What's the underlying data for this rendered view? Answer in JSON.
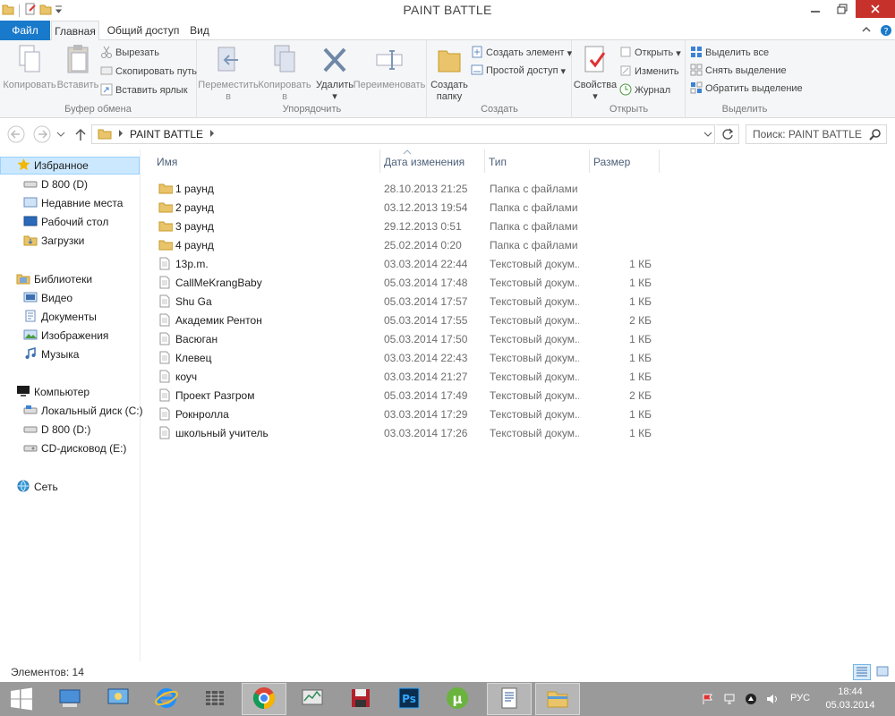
{
  "window": {
    "title": "PAINT BATTLE"
  },
  "tabs": {
    "file": "Файл",
    "home": "Главная",
    "share": "Общий доступ",
    "view": "Вид"
  },
  "ribbon": {
    "clipboard": {
      "label": "Буфер обмена",
      "copy": "Копировать",
      "paste": "Вставить",
      "cut": "Вырезать",
      "copy_path": "Скопировать путь",
      "paste_shortcut": "Вставить ярлык"
    },
    "organize": {
      "label": "Упорядочить",
      "move_to_1": "Переместить",
      "move_to_2": "в",
      "copy_to_1": "Копировать",
      "copy_to_2": "в",
      "delete": "Удалить",
      "rename": "Переименовать"
    },
    "create": {
      "label": "Создать",
      "new_folder_1": "Создать",
      "new_folder_2": "папку",
      "new_item": "Создать элемент",
      "easy_access": "Простой доступ"
    },
    "open": {
      "label": "Открыть",
      "properties": "Свойства",
      "open": "Открыть",
      "edit": "Изменить",
      "history": "Журнал"
    },
    "select": {
      "label": "Выделить",
      "select_all": "Выделить все",
      "select_none": "Снять выделение",
      "invert": "Обратить выделение"
    }
  },
  "address": {
    "path": "PAINT BATTLE",
    "search_placeholder": "Поиск: PAINT BATTLE"
  },
  "nav": {
    "favorites": "Избранное",
    "fav_items": [
      "D 800 (D)",
      "Недавние места",
      "Рабочий стол",
      "Загрузки"
    ],
    "libraries": "Библиотеки",
    "lib_items": [
      "Видео",
      "Документы",
      "Изображения",
      "Музыка"
    ],
    "computer": "Компьютер",
    "comp_items": [
      "Локальный диск (C:)",
      "D 800 (D:)",
      "CD-дисковод (E:)"
    ],
    "network": "Сеть"
  },
  "columns": {
    "name": "Имя",
    "date": "Дата изменения",
    "type": "Тип",
    "size": "Размер"
  },
  "files": [
    {
      "name": "1 раунд",
      "date": "28.10.2013 21:25",
      "type": "Папка с файлами",
      "size": "",
      "kind": "folder"
    },
    {
      "name": "2 раунд",
      "date": "03.12.2013 19:54",
      "type": "Папка с файлами",
      "size": "",
      "kind": "folder"
    },
    {
      "name": "3 раунд",
      "date": "29.12.2013 0:51",
      "type": "Папка с файлами",
      "size": "",
      "kind": "folder"
    },
    {
      "name": "4 раунд",
      "date": "25.02.2014 0:20",
      "type": "Папка с файлами",
      "size": "",
      "kind": "folder"
    },
    {
      "name": "13p.m.",
      "date": "03.03.2014 22:44",
      "type": "Текстовый докум...",
      "size": "1 КБ",
      "kind": "text"
    },
    {
      "name": "CallMeKrangBaby",
      "date": "05.03.2014 17:48",
      "type": "Текстовый докум...",
      "size": "1 КБ",
      "kind": "text"
    },
    {
      "name": "Shu Ga",
      "date": "05.03.2014 17:57",
      "type": "Текстовый докум...",
      "size": "1 КБ",
      "kind": "text"
    },
    {
      "name": "Академик Рентон",
      "date": "05.03.2014 17:55",
      "type": "Текстовый докум...",
      "size": "2 КБ",
      "kind": "text"
    },
    {
      "name": "Васюган",
      "date": "05.03.2014 17:50",
      "type": "Текстовый докум...",
      "size": "1 КБ",
      "kind": "text"
    },
    {
      "name": "Клевец",
      "date": "03.03.2014 22:43",
      "type": "Текстовый докум...",
      "size": "1 КБ",
      "kind": "text"
    },
    {
      "name": "коуч",
      "date": "03.03.2014 21:27",
      "type": "Текстовый докум...",
      "size": "1 КБ",
      "kind": "text"
    },
    {
      "name": "Проект Разгром",
      "date": "05.03.2014 17:49",
      "type": "Текстовый докум...",
      "size": "2 КБ",
      "kind": "text"
    },
    {
      "name": "Рокнролла",
      "date": "03.03.2014 17:29",
      "type": "Текстовый докум...",
      "size": "1 КБ",
      "kind": "text"
    },
    {
      "name": "школьный учитель",
      "date": "03.03.2014 17:26",
      "type": "Текстовый докум...",
      "size": "1 КБ",
      "kind": "text"
    }
  ],
  "status": {
    "items": "Элементов: 14"
  },
  "taskbar": {
    "apps": [
      "network-settings-icon",
      "control-panel-icon",
      "internet-explorer-icon",
      "media-app-icon",
      "chrome-icon",
      "task-manager-icon",
      "save-app-icon",
      "photoshop-icon",
      "utorrent-icon",
      "word-document-icon",
      "file-explorer-icon"
    ],
    "lang": "РУС",
    "time": "18:44",
    "date": "05.03.2014"
  },
  "colors": {
    "accent": "#1979ca",
    "folder": "#e9c46a",
    "selection": "#cce8ff",
    "taskbar": "#9a9a9a",
    "close": "#c7312b"
  }
}
